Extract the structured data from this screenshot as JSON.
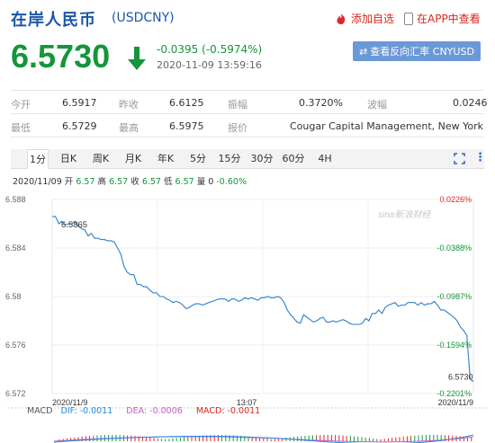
{
  "header": {
    "title": "在岸人民币",
    "code": "(USDCNY)",
    "fav_label": "添加自选",
    "app_label": "在APP中查看"
  },
  "quote": {
    "price": "6.5730",
    "change": "-0.0395 (-0.5974%)",
    "time": "2020-11-09 13:59:16",
    "reverse_label": "查看反向汇率 CNYUSD"
  },
  "stats": {
    "row1": [
      {
        "label": "今开",
        "value": "6.5917"
      },
      {
        "label": "昨收",
        "value": "6.6125"
      },
      {
        "label": "振幅",
        "value": "0.3720%"
      },
      {
        "label": "波幅",
        "value": "0.0246"
      }
    ],
    "row2": [
      {
        "label": "最低",
        "value": "6.5729"
      },
      {
        "label": "最高",
        "value": "6.5975"
      },
      {
        "label": "报价",
        "value": "Cougar Capital Management, New York"
      }
    ]
  },
  "tabs": [
    "1分",
    "日K",
    "周K",
    "月K",
    "年K",
    "5分",
    "15分",
    "30分",
    "60分",
    "4H"
  ],
  "active_tab": 0,
  "ohlc": {
    "date": "2020/11/09",
    "open_label": "开",
    "open": "6.57",
    "high_label": "高",
    "high": "6.57",
    "close_label": "收",
    "close": "6.57",
    "low_label": "低",
    "low": "6.57",
    "vol_label": "量",
    "vol": "0",
    "pct": "-0.60%"
  },
  "watermark": "sina新浪财经",
  "colors": {
    "up": "#e0262a",
    "down": "#14963a",
    "line": "#2f7fc8",
    "accent": "#1a56a8"
  },
  "chart_data": {
    "type": "line",
    "y_ticks": [
      "6.588",
      "6.584",
      "6.58",
      "6.576",
      "6.572"
    ],
    "y_tick_values": [
      6.588,
      6.584,
      6.58,
      6.576,
      6.572
    ],
    "pct_ticks": [
      "0.0226%",
      "-0.0388%",
      "-0.0987%",
      "-0.1594%",
      "-0.2201%"
    ],
    "ylim": [
      6.572,
      6.588
    ],
    "x_labels": [
      "2020/11/9",
      "13:07",
      "2020/11/9"
    ],
    "annotations": {
      "high": "6.5865",
      "last": "6.5730"
    },
    "series": [
      {
        "values": [
          6.5866,
          6.5866,
          6.586,
          6.5862,
          6.5859,
          6.586,
          6.586,
          6.5862,
          6.5858,
          6.5856,
          6.5855,
          6.585,
          6.5852,
          6.5848,
          6.5848,
          6.5847,
          6.5847,
          6.5846,
          6.5846,
          6.5845,
          6.584,
          6.5835,
          6.5825,
          6.582,
          6.5818,
          6.5818,
          6.581,
          6.581,
          6.5808,
          6.5808,
          6.5805,
          6.5803,
          6.5803,
          6.58,
          6.58,
          6.5798,
          6.5797,
          6.5795,
          6.5796,
          6.5795,
          6.5793,
          6.579,
          6.5791,
          6.5793,
          6.5794,
          6.5794,
          6.5793,
          6.5794,
          6.5795,
          6.5796,
          6.5797,
          6.5798,
          6.5798,
          6.5798,
          6.5796,
          6.5798,
          6.5798,
          6.5796,
          6.5797,
          6.5799,
          6.5798,
          6.5799,
          6.5798,
          6.5797,
          6.5799,
          6.5799,
          6.58,
          6.5799,
          6.5799,
          6.58,
          6.5799,
          6.5795,
          6.5789,
          6.5785,
          6.5782,
          6.5779,
          6.5778,
          6.5785,
          6.5783,
          6.5781,
          6.5779,
          6.578,
          6.5782,
          6.5783,
          6.5779,
          6.5779,
          6.578,
          6.5779,
          6.578,
          6.5781,
          6.578,
          6.5778,
          6.5777,
          6.5777,
          6.5777,
          6.5778,
          6.5782,
          6.578,
          6.5786,
          6.5786,
          6.5789,
          6.5786,
          6.5791,
          6.5793,
          6.5794,
          6.5795,
          6.5792,
          6.5793,
          6.5793,
          6.5795,
          6.5795,
          6.5795,
          6.5793,
          6.5795,
          6.5793,
          6.5794,
          6.5794,
          6.5796,
          6.5793,
          6.5789,
          6.5789,
          6.5787,
          6.5785,
          6.5783,
          6.578,
          6.5775,
          6.5772,
          6.5768,
          6.5732,
          6.573
        ]
      }
    ]
  },
  "macd": {
    "label": "MACD",
    "dif": "DIF: -0.0011",
    "dea": "DEA: -0.0006",
    "macd": "MACD: -0.0011"
  }
}
